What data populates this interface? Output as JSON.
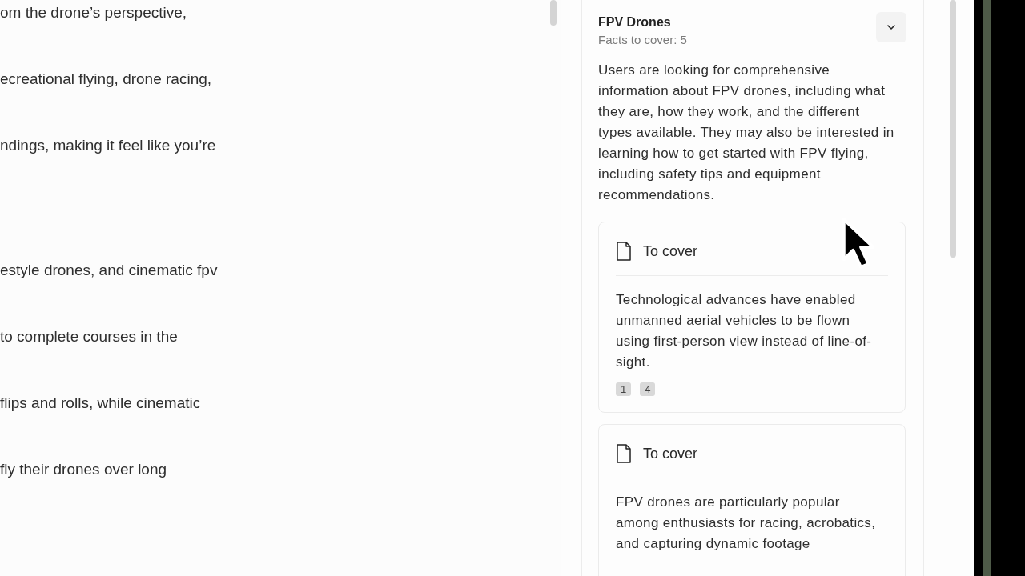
{
  "editor": {
    "paragraphs": [
      {
        "lines": [
          "om the drone’s perspective,",
          "ecreational flying, drone racing,",
          "ndings, making it feel like you’re"
        ]
      },
      {
        "lines": [
          "estyle drones, and cinematic fpv",
          "to complete courses in the",
          "flips and rolls, while cinematic",
          "fly their drones over long"
        ]
      }
    ]
  },
  "topic": {
    "title": "FPV Drones",
    "subtitle": "Facts to cover: 5",
    "description": "Users are looking for comprehensive information about FPV drones, including what they are, how they work, and the different types available. They may also be interested in learning how to get started with FPV flying, including safety tips and equipment recommendations.",
    "facts": [
      {
        "label": "To cover",
        "text": "Technological advances have enabled unmanned aerial vehicles to be flown using first-person view instead of line-of-sight.",
        "refs": [
          "1",
          "4"
        ]
      },
      {
        "label": "To cover",
        "text": "FPV drones are particularly popular among enthusiasts for racing, acrobatics, and capturing dynamic footage"
      }
    ]
  }
}
